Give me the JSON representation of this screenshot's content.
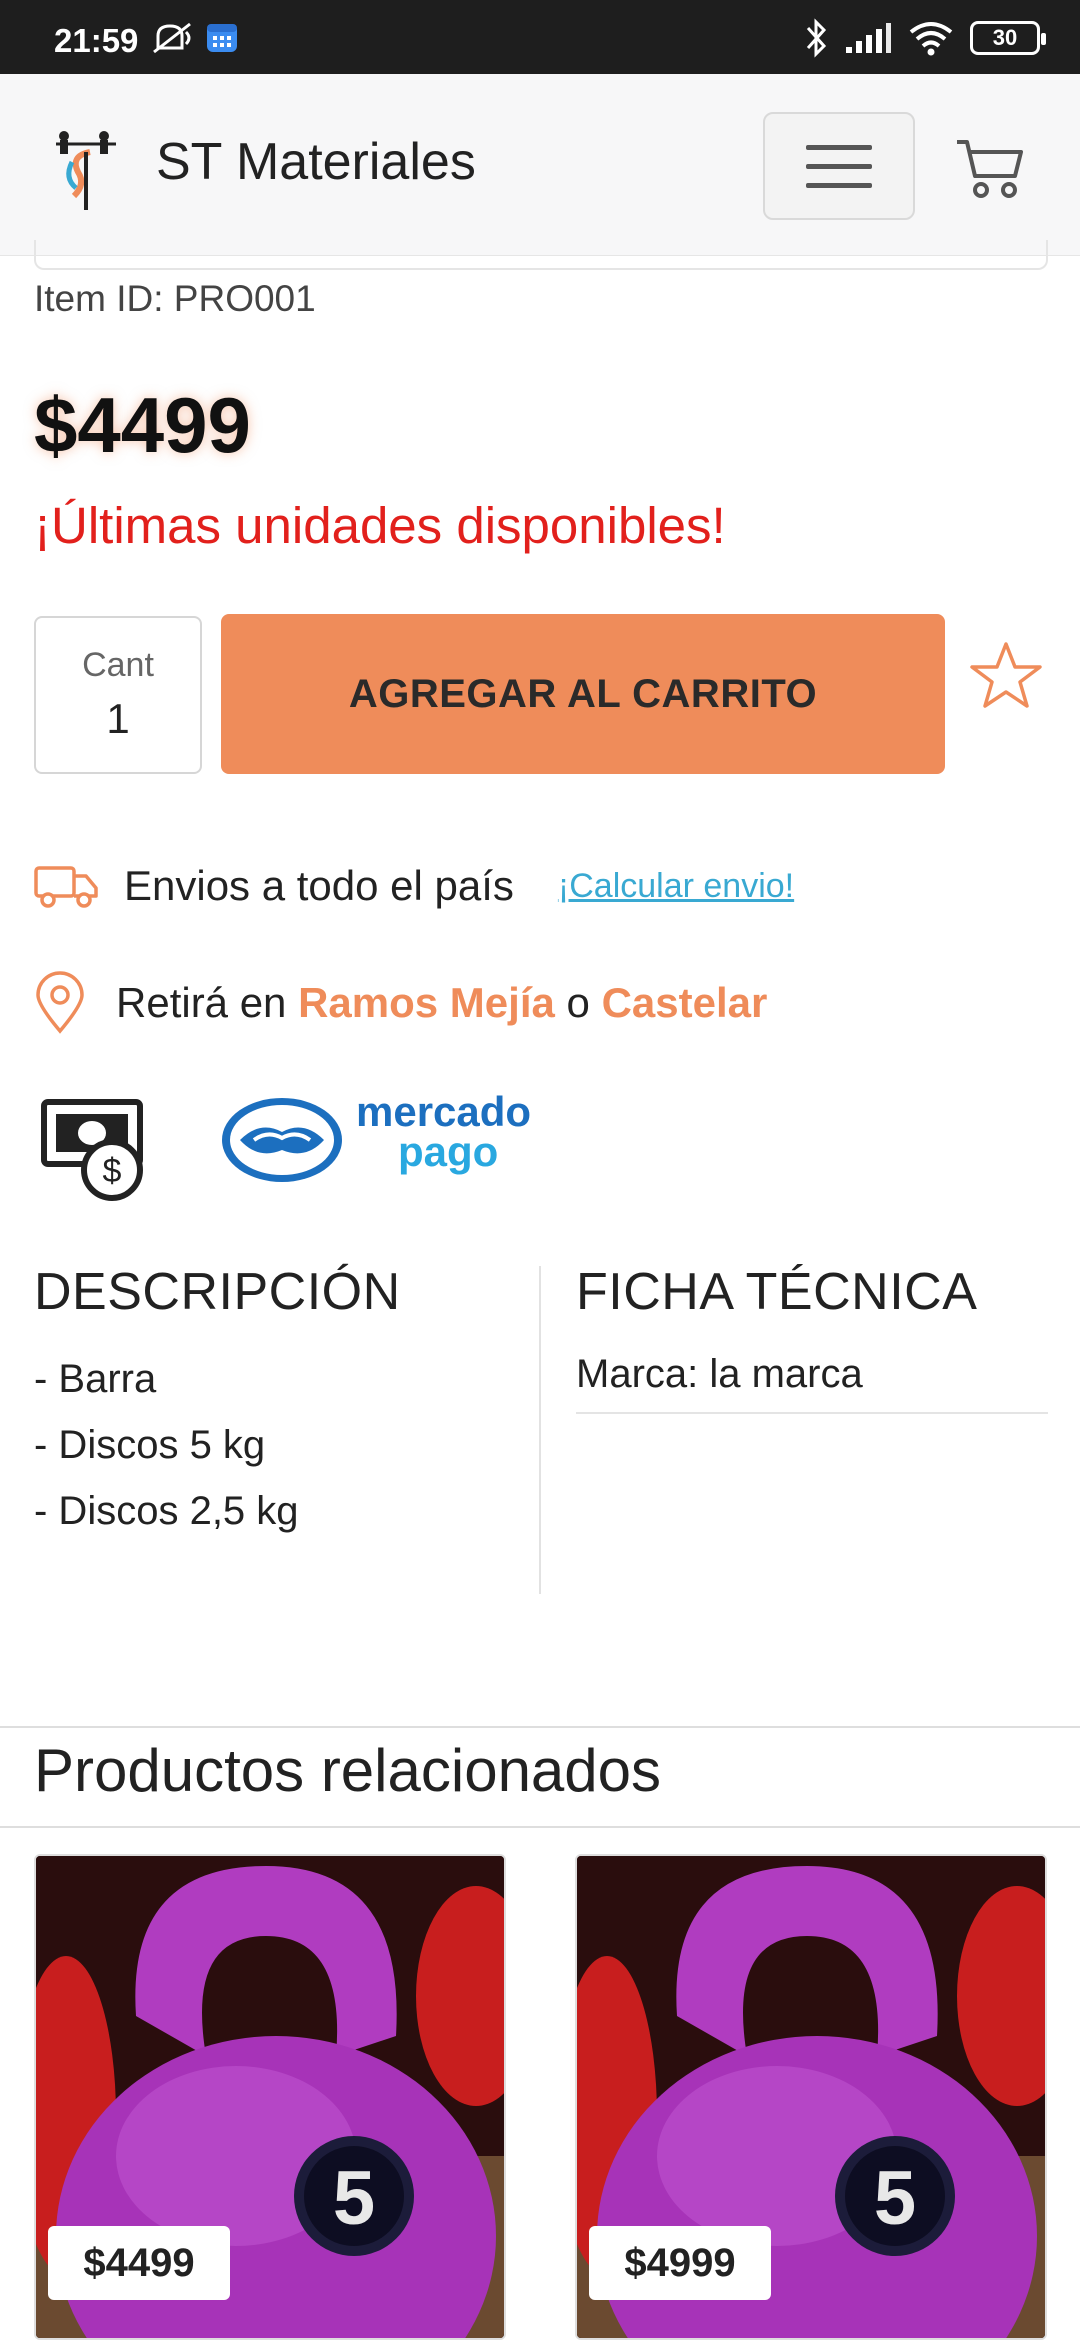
{
  "status_bar": {
    "time": "21:59",
    "battery": "30"
  },
  "header": {
    "brand": "ST Materiales"
  },
  "product": {
    "item_id": "Item ID: PRO001",
    "price": "$4499",
    "stock_message": "¡Últimas unidades disponibles!",
    "quantity_label": "Cant",
    "quantity_value": "1",
    "add_to_cart_label": "AGREGAR AL CARRITO"
  },
  "shipping": {
    "text": "Envios a todo el país",
    "calc_link": "¡Calcular envio!"
  },
  "pickup": {
    "prefix": "Retirá en",
    "location_1": "Ramos Mejía",
    "connector": "o",
    "location_2": "Castelar"
  },
  "payment": {
    "mp_line1": "mercado",
    "mp_line2": "pago"
  },
  "description": {
    "title": "DESCRIPCIÓN",
    "items": [
      "- Barra",
      "- Discos 5 kg",
      "- Discos 2,5 kg"
    ]
  },
  "ficha": {
    "title": "FICHA TÉCNICA",
    "rows": [
      "Marca: la marca"
    ]
  },
  "related": {
    "title": "Productos relacionados",
    "items": [
      {
        "price": "$4499",
        "badge": "5"
      },
      {
        "price": "$4999",
        "badge": "5"
      }
    ]
  },
  "colors": {
    "accent": "#ef8c5a",
    "stock_red": "#e2201c",
    "link_blue": "#39a9d2",
    "kettlebell": "#b03cc0"
  },
  "icons": [
    "mute-icon",
    "calendar-icon",
    "bluetooth-icon",
    "signal-icon",
    "wifi-icon",
    "battery-icon",
    "menu-icon",
    "cart-icon",
    "star-icon",
    "truck-icon",
    "location-pin-icon",
    "cash-icon",
    "mercadopago-logo"
  ]
}
